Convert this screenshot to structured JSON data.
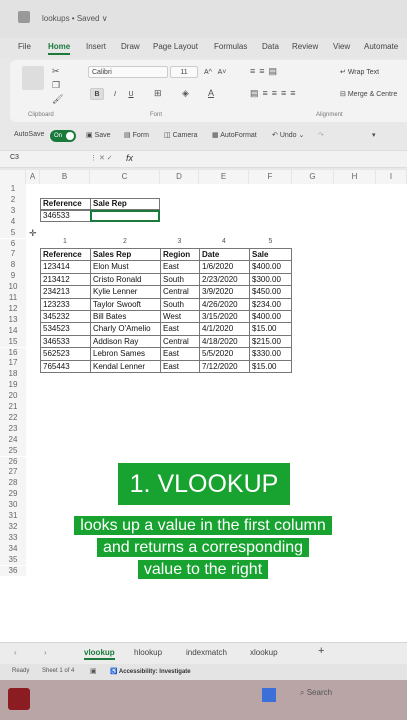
{
  "window": {
    "title": "lookups • Saved ∨"
  },
  "menu": [
    "File",
    "Home",
    "Insert",
    "Draw",
    "Page Layout",
    "Formulas",
    "Data",
    "Review",
    "View",
    "Automate"
  ],
  "ribbon": {
    "font_name": "Calibri",
    "font_size": "11",
    "grow_font": "A^",
    "shrink_font": "A˅",
    "bold": "B",
    "italic": "I",
    "underline": "U",
    "wrap_text": "Wrap Text",
    "merge": "Merge & Centre",
    "groups": {
      "clipboard": "Clipboard",
      "font": "Font",
      "alignment": "Alignment"
    }
  },
  "qat": {
    "autosave": "AutoSave",
    "toggle": "On",
    "save": "Save",
    "form": "Form",
    "camera": "Camera",
    "autoformat": "AutoFormat",
    "undo": "Undo"
  },
  "formula_bar": {
    "name_box": "C3",
    "fx": "fx",
    "value": ""
  },
  "columns": [
    "A",
    "B",
    "C",
    "D",
    "E",
    "F",
    "G",
    "H",
    "I"
  ],
  "rows": [
    "1",
    "2",
    "3",
    "4",
    "5",
    "6",
    "7",
    "8",
    "9",
    "10",
    "11",
    "12",
    "13",
    "14",
    "15",
    "16",
    "17",
    "18",
    "19",
    "20",
    "21",
    "22",
    "23",
    "24",
    "25",
    "26",
    "27",
    "28",
    "29",
    "30",
    "31",
    "32",
    "33",
    "34",
    "35",
    "36"
  ],
  "lookup_box": {
    "headers": [
      "Reference",
      "Sale Rep"
    ],
    "values": [
      "346533",
      ""
    ]
  },
  "column_indexes": [
    "1",
    "2",
    "3",
    "4",
    "5"
  ],
  "table": {
    "headers": [
      "Reference",
      "Sales Rep",
      "Region",
      "Date",
      "Sale"
    ],
    "rows": [
      [
        "123414",
        "Elon Must",
        "East",
        "1/6/2020",
        "$400.00"
      ],
      [
        "213412",
        "Cristo Ronald",
        "South",
        "2/23/2020",
        "$300.00"
      ],
      [
        "234213",
        "Kylie Lenner",
        "Central",
        "3/9/2020",
        "$450.00"
      ],
      [
        "123233",
        "Taylor Swooft",
        "South",
        "4/26/2020",
        "$234.00"
      ],
      [
        "345232",
        "Bill Bates",
        "West",
        "3/15/2020",
        "$400.00"
      ],
      [
        "534523",
        "Charly O'Amelio",
        "East",
        "4/1/2020",
        "$15.00"
      ],
      [
        "346533",
        "Addison Ray",
        "Central",
        "4/18/2020",
        "$215.00"
      ],
      [
        "562523",
        "Lebron Sames",
        "East",
        "5/5/2020",
        "$330.00"
      ],
      [
        "765443",
        "Kendal Lenner",
        "East",
        "7/12/2020",
        "$15.00"
      ]
    ]
  },
  "overlay": {
    "title": "1. VLOOKUP",
    "line1": "looks up a value in the first column",
    "line2": "and returns a corresponding",
    "line3": "value to the right"
  },
  "tabs": [
    "vlookup",
    "hlookup",
    "indexmatch",
    "xlookup"
  ],
  "status": {
    "ready": "Ready",
    "sheet": "Sheet 1 of 4",
    "accessibility": "Accessibility: Investigate"
  },
  "taskbar": {
    "search": "Search"
  },
  "colors": {
    "excel_green": "#1a7a3c",
    "overlay_green": "#18a331"
  }
}
